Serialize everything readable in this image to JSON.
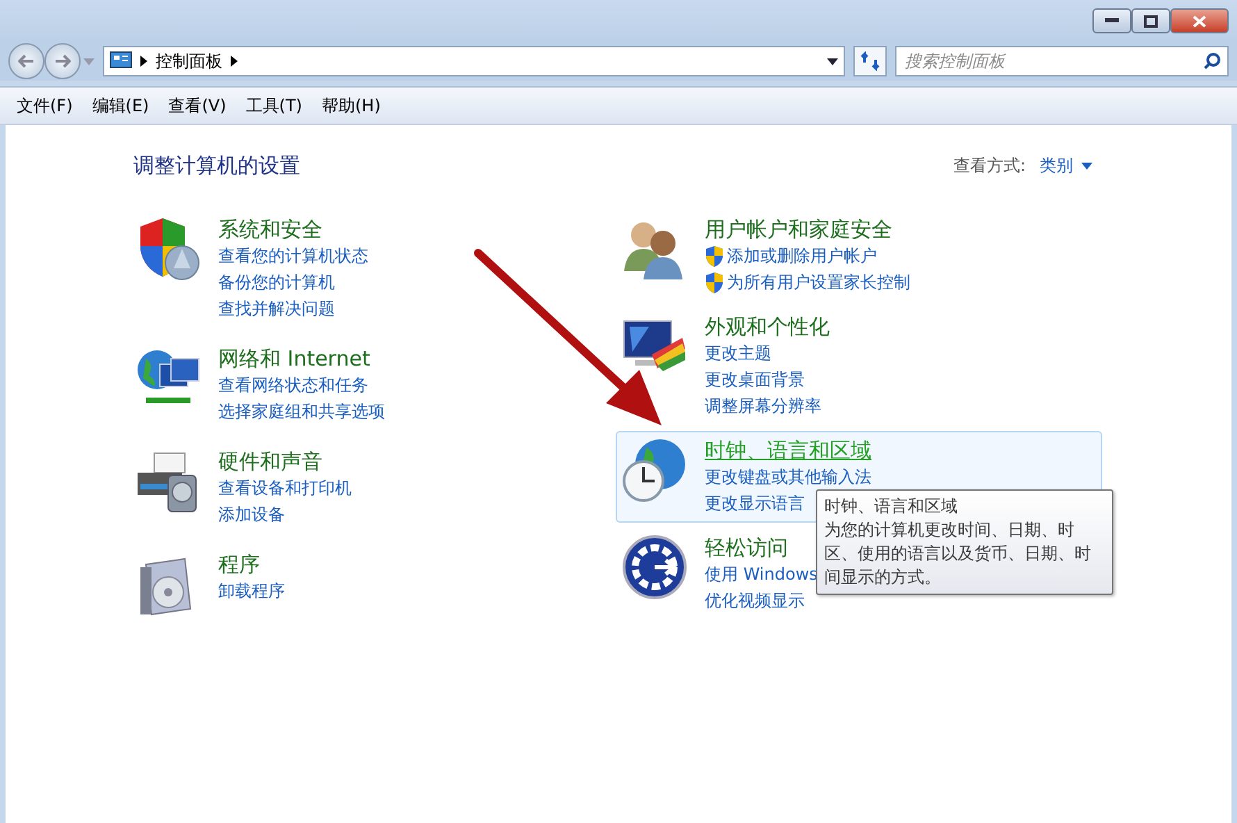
{
  "address_bar": {
    "path": "控制面板",
    "search_placeholder": "搜索控制面板"
  },
  "menu_bar": [
    "文件(F)",
    "编辑(E)",
    "查看(V)",
    "工具(T)",
    "帮助(H)"
  ],
  "content": {
    "heading": "调整计算机的设置",
    "view_by_label": "查看方式:",
    "view_by_value": "类别",
    "columns": [
      [
        {
          "title": "系统和安全",
          "highlighted": false,
          "links": [
            {
              "text": "查看您的计算机状态",
              "uac": false
            },
            {
              "text": "备份您的计算机",
              "uac": false
            },
            {
              "text": "查找并解决问题",
              "uac": false
            }
          ]
        },
        {
          "title": "网络和 Internet",
          "highlighted": false,
          "links": [
            {
              "text": "查看网络状态和任务",
              "uac": false
            },
            {
              "text": "选择家庭组和共享选项",
              "uac": false
            }
          ]
        },
        {
          "title": "硬件和声音",
          "highlighted": false,
          "links": [
            {
              "text": "查看设备和打印机",
              "uac": false
            },
            {
              "text": "添加设备",
              "uac": false
            }
          ]
        },
        {
          "title": "程序",
          "highlighted": false,
          "links": [
            {
              "text": "卸载程序",
              "uac": false
            }
          ]
        }
      ],
      [
        {
          "title": "用户帐户和家庭安全",
          "highlighted": false,
          "links": [
            {
              "text": "添加或删除用户帐户",
              "uac": true
            },
            {
              "text": "为所有用户设置家长控制",
              "uac": true
            }
          ]
        },
        {
          "title": "外观和个性化",
          "highlighted": false,
          "links": [
            {
              "text": "更改主题",
              "uac": false
            },
            {
              "text": "更改桌面背景",
              "uac": false
            },
            {
              "text": "调整屏幕分辨率",
              "uac": false
            }
          ]
        },
        {
          "title": "时钟、语言和区域",
          "highlighted": true,
          "links": [
            {
              "text": "更改键盘或其他输入法",
              "uac": false
            },
            {
              "text": "更改显示语言",
              "uac": false
            }
          ]
        },
        {
          "title": "轻松访问",
          "highlighted": false,
          "links": [
            {
              "text": "使用 Windows",
              "uac": false
            },
            {
              "text": "优化视频显示",
              "uac": false
            }
          ]
        }
      ]
    ]
  },
  "tooltip": {
    "title": "时钟、语言和区域",
    "text": "为您的计算机更改时间、日期、时区、使用的语言以及货币、日期、时间显示的方式。"
  }
}
